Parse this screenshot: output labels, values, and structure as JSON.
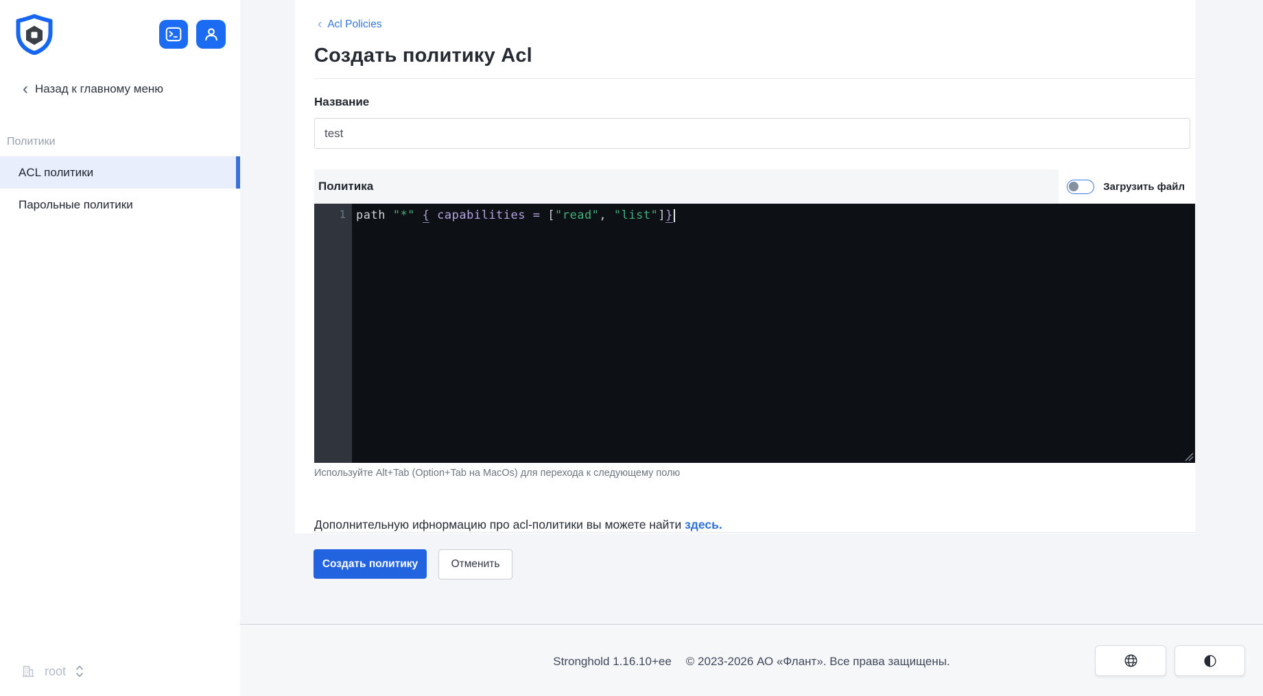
{
  "icons": {
    "back_chevron": "‹",
    "breadcrumb_chevron": "‹",
    "logo": "shield-hexagon",
    "terminal": "terminal-prompt",
    "user": "person",
    "namespace": "building",
    "namespace_select": "chevron-up-down",
    "language": "globe",
    "theme": "half-circle-contrast",
    "resize": "diagonal-resize-grip"
  },
  "sidebar": {
    "back_label": "Назад к главному меню",
    "section_label": "Политики",
    "nav": [
      {
        "label": "ACL политики",
        "active": true
      },
      {
        "label": "Парольные политики",
        "active": false
      }
    ],
    "namespace": "root"
  },
  "main": {
    "breadcrumb": {
      "label": "Acl Policies"
    },
    "title": "Создать политику Acl",
    "name_field": {
      "label": "Название",
      "value": "test"
    },
    "policy": {
      "label": "Политика",
      "upload_toggle_label": "Загрузить файл",
      "upload_toggle_on": false,
      "editor": {
        "line_number": "1",
        "code_plain": "path \"*\" { capabilities = [\"read\", \"list\"]}",
        "tokens": [
          {
            "text": "path",
            "type": "variable"
          },
          {
            "text": " ",
            "type": "plain"
          },
          {
            "text": "\"*\"",
            "type": "string"
          },
          {
            "text": " ",
            "type": "plain"
          },
          {
            "text": "{",
            "type": "brace"
          },
          {
            "text": " ",
            "type": "plain"
          },
          {
            "text": "capabilities",
            "type": "attribute"
          },
          {
            "text": " ",
            "type": "plain"
          },
          {
            "text": "=",
            "type": "operator"
          },
          {
            "text": " ",
            "type": "plain"
          },
          {
            "text": "[",
            "type": "bracket"
          },
          {
            "text": "\"read\"",
            "type": "string"
          },
          {
            "text": ",",
            "type": "plain"
          },
          {
            "text": " ",
            "type": "plain"
          },
          {
            "text": "\"list\"",
            "type": "string"
          },
          {
            "text": "]",
            "type": "bracket"
          },
          {
            "text": "}",
            "type": "brace"
          }
        ]
      }
    },
    "editor_hint": "Используйте Alt+Tab (Option+Tab на MacOs) для перехода к следующему полю",
    "info_text": "Дополнительную ифнормацию про acl-политики вы можете найти ",
    "info_link": "здесь.",
    "buttons": {
      "submit": "Создать политику",
      "cancel": "Отменить"
    }
  },
  "footer": {
    "version": "Stronghold 1.16.10+ee",
    "copyright": "© 2023-2026 АО «Флант». Все права защищены."
  },
  "colors": {
    "accent_blue": "#2264e0",
    "icon_button_blue": "#1b6cf2",
    "link_blue": "#3276dd",
    "active_item_bg": "#e8eefb",
    "active_item_border": "#3a6fd8",
    "editor_bg": "#0d1014",
    "editor_gutter_bg": "#2f343d",
    "string_green": "#45b07a",
    "identifier_purple": "#b6a5e0"
  }
}
